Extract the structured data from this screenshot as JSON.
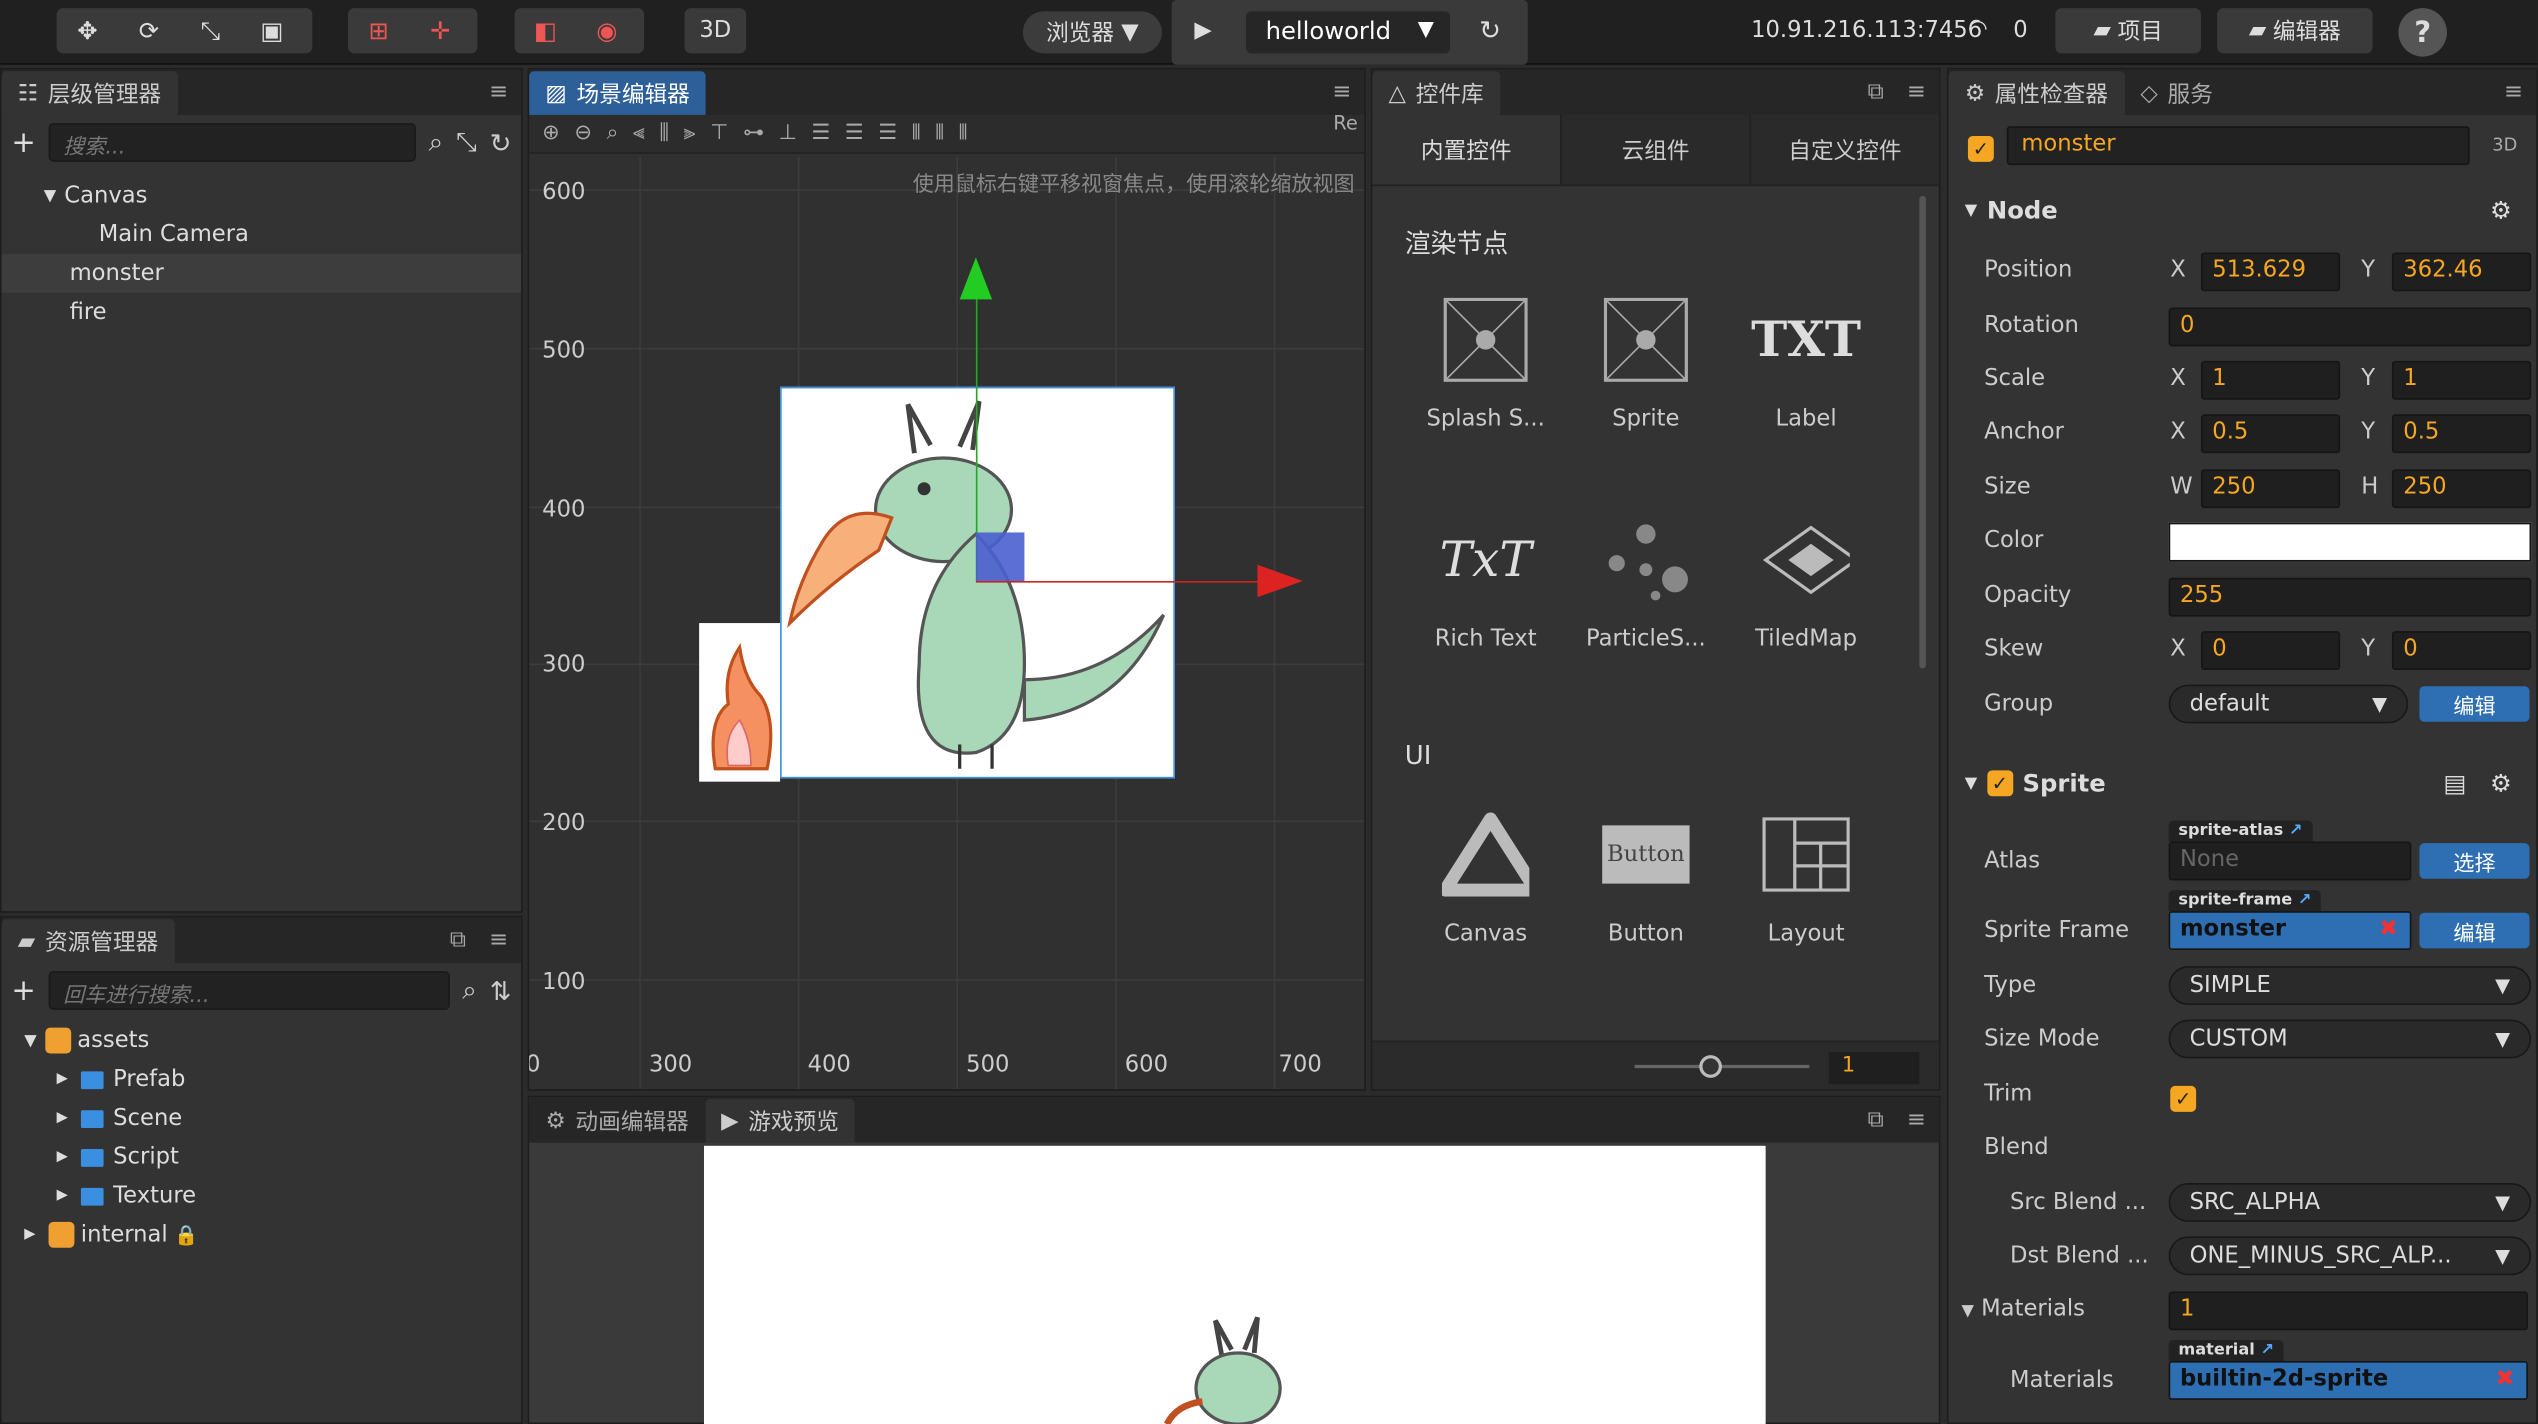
{
  "toolbar": {
    "preview_label": "浏览器",
    "scene_name": "helloworld",
    "btn_3d": "3D",
    "ip_address": "10.91.216.113:7456",
    "conn_count": "0",
    "project_label": "项目",
    "editor_label": "编辑器",
    "help": "?"
  },
  "hierarchy": {
    "title": "层级管理器",
    "search_placeholder": "搜索...",
    "items": [
      "Canvas",
      "Main Camera",
      "monster",
      "fire"
    ]
  },
  "assets": {
    "title": "资源管理器",
    "search_placeholder": "回车进行搜索...",
    "root": "assets",
    "folders": [
      "Prefab",
      "Scene",
      "Script",
      "Texture"
    ],
    "internal": "internal"
  },
  "scene": {
    "title": "场景编辑器",
    "hint": "使用鼠标右键平移视窗焦点，使用滚轮缩放视图",
    "ruler_right": "Re",
    "y_ticks": [
      "600",
      "500",
      "400",
      "300",
      "200",
      "100"
    ],
    "x_ticks": [
      "0",
      "300",
      "400",
      "500",
      "600",
      "700"
    ]
  },
  "widgets": {
    "title": "控件库",
    "tabs": [
      "内置控件",
      "云组件",
      "自定义控件"
    ],
    "section_render": "渲染节点",
    "render_items": [
      "Splash S...",
      "Sprite",
      "Label",
      "Rich Text",
      "ParticleS...",
      "TiledMap"
    ],
    "section_ui": "UI",
    "ui_items": [
      "Canvas",
      "Button",
      "Layout"
    ],
    "zoom_value": "1",
    "button_preview_text": "Button",
    "txt_icon": "TXT",
    "richtext_icon": "TxT"
  },
  "bottom": {
    "tab_anim": "动画编辑器",
    "tab_game": "游戏预览"
  },
  "inspector": {
    "title": "属性检查器",
    "tab_service": "服务",
    "node_name": "monster",
    "tag_3d": "3D",
    "node_section": "Node",
    "position": {
      "label": "Position",
      "x": "513.629",
      "y": "362.46"
    },
    "rotation": {
      "label": "Rotation",
      "value": "0"
    },
    "scale": {
      "label": "Scale",
      "x": "1",
      "y": "1"
    },
    "anchor": {
      "label": "Anchor",
      "x": "0.5",
      "y": "0.5"
    },
    "size": {
      "label": "Size",
      "w": "250",
      "h": "250"
    },
    "color": {
      "label": "Color",
      "value": "#ffffff"
    },
    "opacity": {
      "label": "Opacity",
      "value": "255"
    },
    "skew": {
      "label": "Skew",
      "x": "0",
      "y": "0"
    },
    "group": {
      "label": "Group",
      "value": "default",
      "edit": "编辑"
    },
    "sprite_section": "Sprite",
    "atlas": {
      "label": "Atlas",
      "tag": "sprite-atlas",
      "value": "None",
      "select": "选择"
    },
    "sprite_frame": {
      "label": "Sprite Frame",
      "tag": "sprite-frame",
      "value": "monster",
      "edit": "编辑"
    },
    "type": {
      "label": "Type",
      "value": "SIMPLE"
    },
    "size_mode": {
      "label": "Size Mode",
      "value": "CUSTOM"
    },
    "trim": {
      "label": "Trim"
    },
    "blend": {
      "label": "Blend"
    },
    "src_blend": {
      "label": "Src Blend ...",
      "value": "SRC_ALPHA"
    },
    "dst_blend": {
      "label": "Dst Blend ...",
      "value": "ONE_MINUS_SRC_ALP..."
    },
    "materials_count": {
      "label": "Materials",
      "value": "1"
    },
    "material": {
      "label": "Materials",
      "tag": "material",
      "value": "builtin-2d-sprite"
    },
    "xy": {
      "x": "X",
      "y": "Y",
      "w": "W",
      "h": "H"
    }
  }
}
